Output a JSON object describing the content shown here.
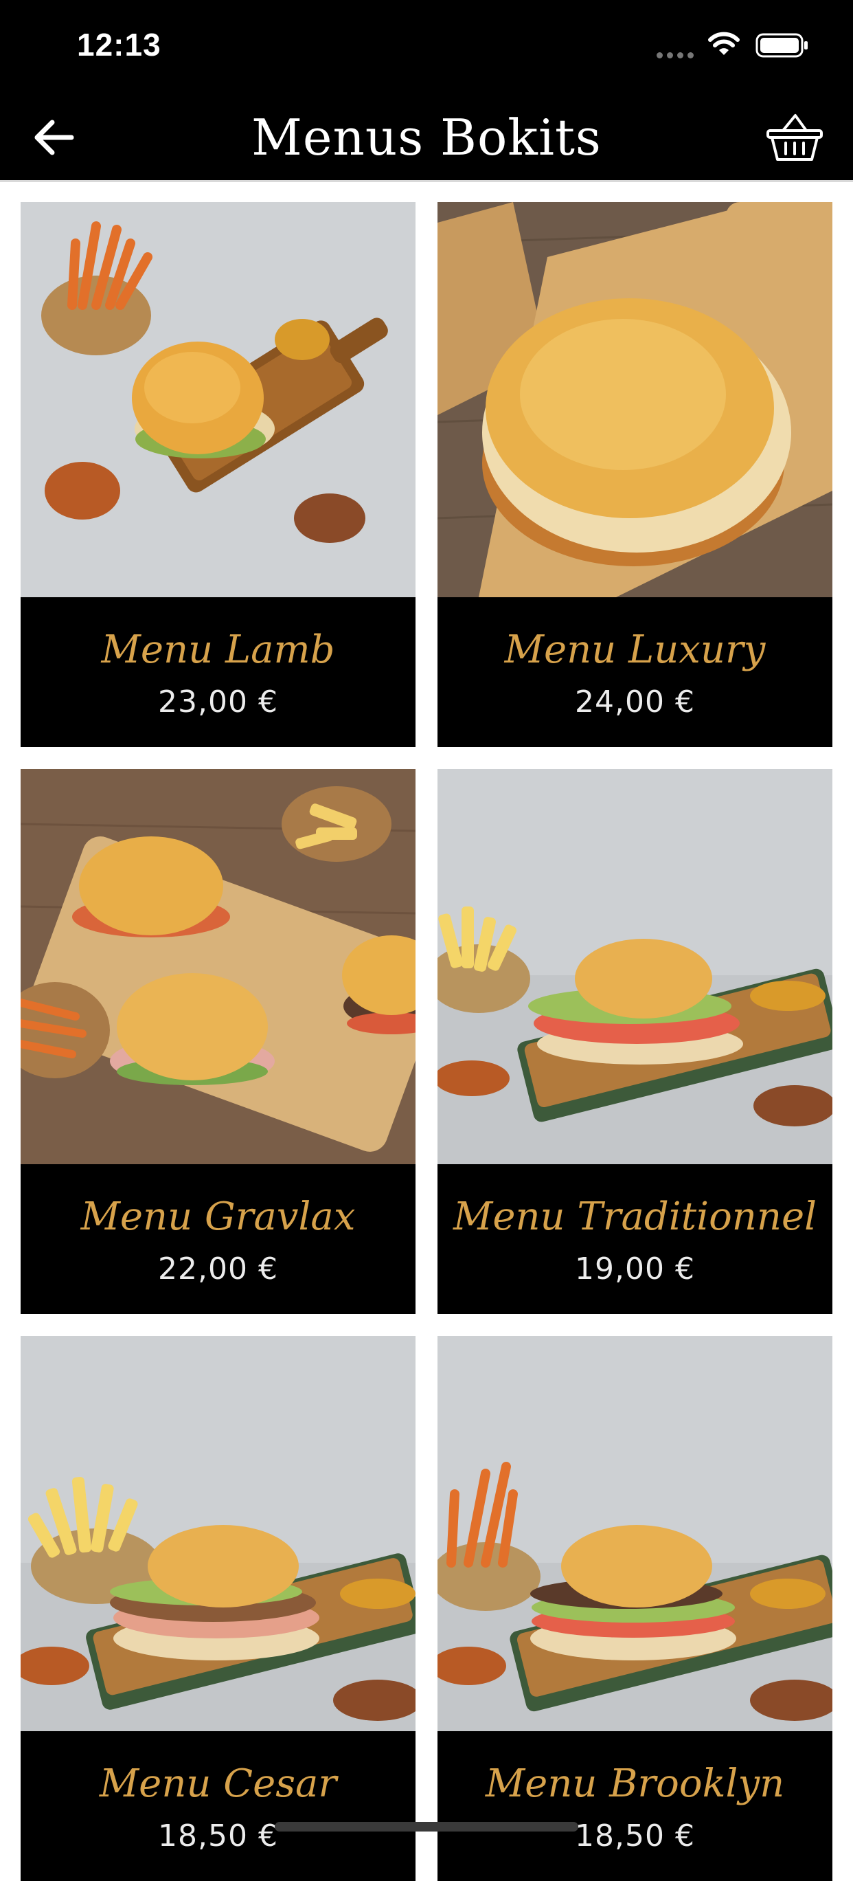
{
  "status_bar": {
    "time": "12:13"
  },
  "nav": {
    "title": "Menus Bokits",
    "back_icon": "arrow-left-icon",
    "cart_icon": "basket-icon"
  },
  "colors": {
    "bar_background": "#000000",
    "accent_gold": "#d7a24b",
    "price_text": "#ececec"
  },
  "menus": [
    {
      "name": "Menu Lamb",
      "price": "23,00 €",
      "photo": "burger-on-board-with-sweet-potato-fries"
    },
    {
      "name": "Menu Luxury",
      "price": "24,00 €",
      "photo": "burger-on-wooden-board-closeup"
    },
    {
      "name": "Menu Gravlax",
      "price": "22,00 €",
      "photo": "three-burgers-with-fries-on-board"
    },
    {
      "name": "Menu Traditionnel",
      "price": "19,00 €",
      "photo": "burger-on-green-board-with-fries"
    },
    {
      "name": "Menu Cesar",
      "price": "18,50 €",
      "photo": "chicken-burger-on-green-board-with-fries"
    },
    {
      "name": "Menu Brooklyn",
      "price": "18,50 €",
      "photo": "burger-on-green-board-with-sweet-potato-fries"
    }
  ]
}
